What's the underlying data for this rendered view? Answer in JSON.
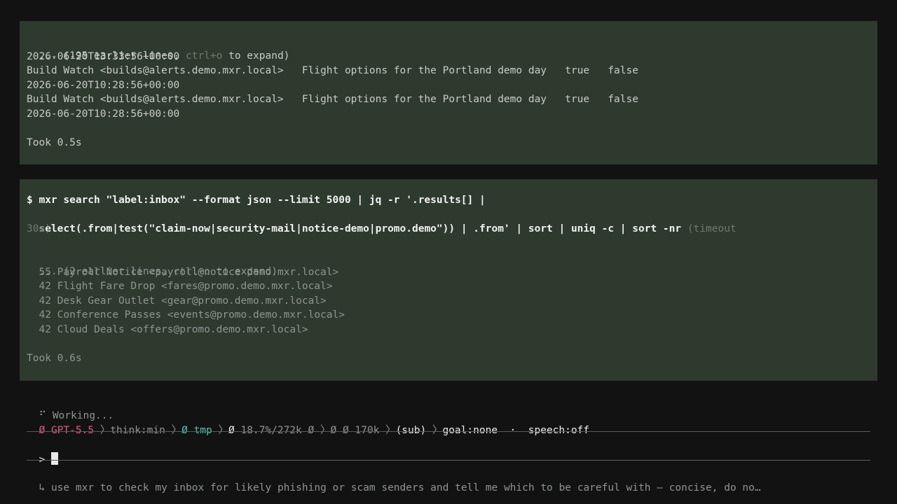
{
  "block1": {
    "lines": [
      "2026-06-20T13:33:56+00:00",
      "Build Watch <builds@alerts.demo.mxr.local>   Flight options for the Portland demo day   true   false",
      "2026-06-20T10:28:56+00:00",
      "Build Watch <builds@alerts.demo.mxr.local>   Flight options for the Portland demo day   true   false",
      "2026-06-20T10:28:56+00:00"
    ],
    "collapsed_prefix": "... (195 earlier lines, ",
    "collapsed_key": "ctrl+o",
    "collapsed_suffix": " to expand)",
    "took": "Took 0.5s"
  },
  "block2": {
    "command_line1": "$ mxr search \"label:inbox\" --format json --limit 5000 | jq -r '.results[] |",
    "command_line2": "select(.from|test(\"claim-now|security-mail|notice-demo|promo.demo\")) | .from' | sort | uniq -c | sort -nr",
    "timeout_part1": " (timeout",
    "timeout_part2": "30s)",
    "collapsed_prefix": "... (2 earlier lines, ",
    "collapsed_key": "ctrl+o",
    "collapsed_suffix": " to expand)",
    "results": [
      "  55 Payroll Notice <payroll@notice-demo.mxr.local>",
      "  42 Flight Fare Drop <fares@promo.demo.mxr.local>",
      "  42 Desk Gear Outlet <gear@promo.demo.mxr.local>",
      "  42 Conference Passes <events@promo.demo.mxr.local>",
      "  42 Cloud Deals <offers@promo.demo.mxr.local>"
    ],
    "took": "Took 0.6s"
  },
  "status": {
    "spinner": "⠋",
    "working": "Working...",
    "model_glyph": "Ø",
    "model": "GPT-5.5",
    "think": "think:min",
    "dir_glyph": "Ø",
    "dir": "tmp",
    "ctx_glyph": "Ø",
    "ctx": "18.7%/272k",
    "ctx_glyph2": "Ø",
    "tokens_glyph1": "Ø",
    "tokens_glyph2": "Ø",
    "tokens": "170k",
    "sub": "(sub)",
    "goal": "goal:none",
    "dot": "·",
    "speech": "speech:off"
  },
  "prompt": {
    "symbol": ">",
    "value": ""
  },
  "queued": {
    "arrow": "↳",
    "text": "use mxr to check my inbox for likely phishing or scam senders and tell me which to be careful with — concise, do no…"
  },
  "colors": {
    "panel_bg": "#2e3a2e",
    "page_bg": "#121212",
    "accent_teal": "#4cc4b4",
    "accent_pink": "#e05a82"
  }
}
